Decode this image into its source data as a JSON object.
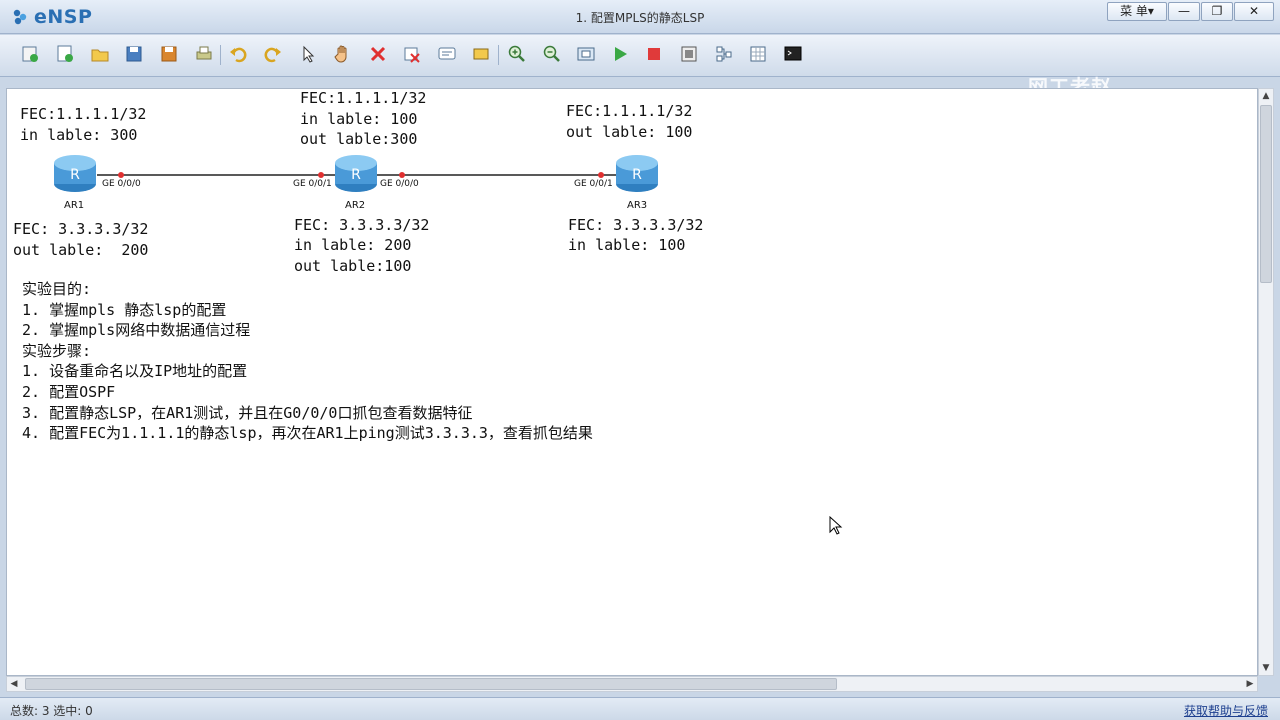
{
  "app": {
    "name": "eNSP",
    "window_title": "1. 配置MPLS的静态LSP",
    "menu_label": "菜 单▾",
    "min_label": "—",
    "max_label": "❐",
    "close_label": "✕",
    "watermark": "网工老赵"
  },
  "toolbar": {
    "icons": [
      "new-topology-icon",
      "new-icon",
      "open-icon",
      "save-icon",
      "save-as-icon",
      "print-icon",
      "undo-icon",
      "redo-icon",
      "select-icon",
      "pan-hand-icon",
      "delete-icon",
      "delete-link-icon",
      "text-note-icon",
      "rectangle-icon",
      "zoom-in-icon",
      "zoom-out-icon",
      "fit-icon",
      "start-icon",
      "stop-icon",
      "capture-icon",
      "topology-icon",
      "grid-icon",
      "terminal-icon"
    ]
  },
  "topology": {
    "devices": [
      {
        "name": "AR1"
      },
      {
        "name": "AR2"
      },
      {
        "name": "AR3"
      }
    ],
    "interfaces": {
      "ar1_g0": "GE 0/0/0",
      "ar2_g1": "GE 0/0/1",
      "ar2_g0": "GE 0/0/0",
      "ar3_g1": "GE 0/0/1"
    },
    "labels": {
      "ar1_top_1": "FEC:1.1.1.1/32",
      "ar1_top_2": "in lable: 300",
      "ar2_top_1": "FEC:1.1.1.1/32",
      "ar2_top_2": "in lable: 100",
      "ar2_top_3": "out lable:300",
      "ar3_top_1": "FEC:1.1.1.1/32",
      "ar3_top_2": "out lable: 100",
      "ar1_bot_1": "FEC: 3.3.3.3/32",
      "ar1_bot_2": "out lable:  200",
      "ar2_bot_1": "FEC: 3.3.3.3/32",
      "ar2_bot_2": "in lable: 200",
      "ar2_bot_3": "out lable:100",
      "ar3_bot_1": "FEC: 3.3.3.3/32",
      "ar3_bot_2": "in lable: 100"
    }
  },
  "notes": [
    "实验目的:",
    "1. 掌握mpls 静态lsp的配置",
    "2. 掌握mpls网络中数据通信过程",
    "实验步骤:",
    "1. 设备重命名以及IP地址的配置",
    "2. 配置OSPF",
    "3. 配置静态LSP，在AR1测试，并且在G0/0/0口抓包查看数据特征",
    "4. 配置FEC为1.1.1.1的静态lsp，再次在AR1上ping测试3.3.3.3，查看抓包结果"
  ],
  "status": {
    "left": "总数: 3 选中: 0",
    "right": "获取帮助与反馈"
  },
  "colors": {
    "router_body": "#5aa9e6",
    "port_dot": "#e03030",
    "link": "#222222"
  }
}
